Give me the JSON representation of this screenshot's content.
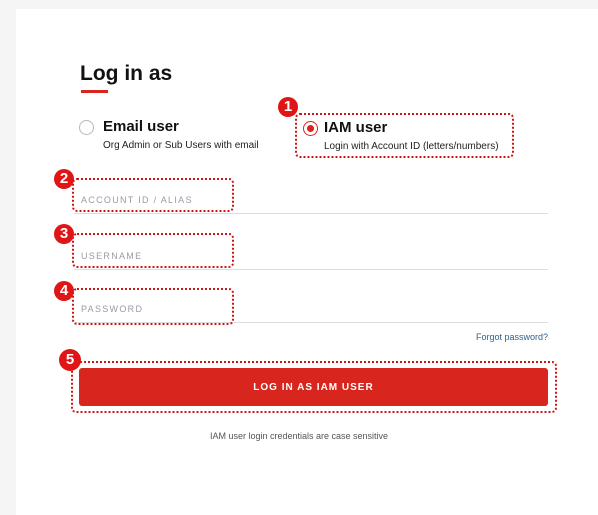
{
  "title": "Log in as",
  "options": [
    {
      "label": "Email user",
      "sub": "Org Admin or Sub Users with email",
      "selected": false
    },
    {
      "label": "IAM user",
      "sub": "Login with Account ID (letters/numbers)",
      "selected": true
    }
  ],
  "fields": {
    "account_placeholder": "ACCOUNT ID / ALIAS",
    "username_placeholder": "USERNAME",
    "password_placeholder": "PASSWORD",
    "account_value": "",
    "username_value": "",
    "password_value": ""
  },
  "forgot_label": "Forgot password?",
  "login_button": "LOG IN AS IAM USER",
  "note": "IAM user login credentials are case sensitive",
  "annotations": [
    "1",
    "2",
    "3",
    "4",
    "5"
  ],
  "colors": {
    "accent": "#d8261f",
    "annotation": "#e01616",
    "link": "#2f5f8a"
  }
}
